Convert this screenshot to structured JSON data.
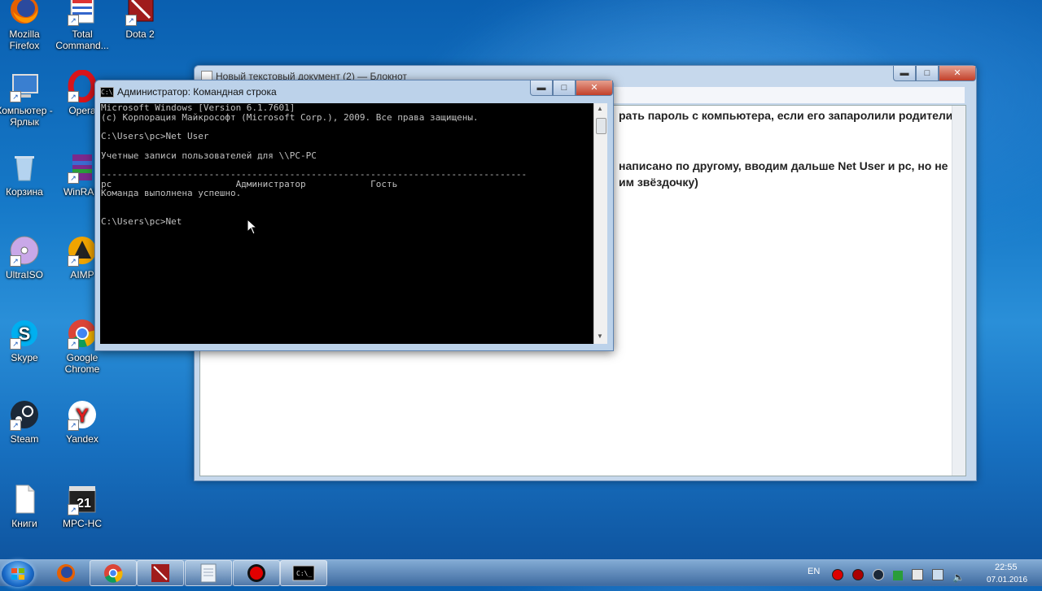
{
  "desktop": {
    "icons": [
      {
        "label": "Mozilla Firefox",
        "icon": "firefox-icon"
      },
      {
        "label": "Total Command...",
        "icon": "total-commander-icon"
      },
      {
        "label": "Dota 2",
        "icon": "dota2-icon"
      },
      {
        "label": "Компьютер - Ярлык",
        "icon": "computer-icon"
      },
      {
        "label": "Opera",
        "icon": "opera-icon"
      },
      {
        "label": "Корзина",
        "icon": "recycle-bin-icon"
      },
      {
        "label": "WinRAR",
        "icon": "winrar-icon"
      },
      {
        "label": "UltraISO",
        "icon": "ultraiso-icon"
      },
      {
        "label": "AIMP",
        "icon": "aimp-icon"
      },
      {
        "label": "Skype",
        "icon": "skype-icon"
      },
      {
        "label": "Google Chrome",
        "icon": "chrome-icon"
      },
      {
        "label": "Steam",
        "icon": "steam-icon"
      },
      {
        "label": "Yandex",
        "icon": "yandex-icon"
      },
      {
        "label": "Книги",
        "icon": "document-icon"
      },
      {
        "label": "MPC-HC",
        "icon": "mpc-hc-icon"
      }
    ]
  },
  "notepad": {
    "title": "Новый текстовый документ (2) — Блокнот",
    "line1": "рать пароль с компьютера, если его запаролили родители)",
    "line2": "написано по другому, вводим дальше Net User и pc, но не",
    "line3": "им звёздочку)"
  },
  "cmd": {
    "title": "Администратор: Командная строка",
    "output": "Microsoft Windows [Version 6.1.7601]\n(c) Корпорация Майкрософт (Microsoft Corp.), 2009. Все права защищены.\n\nC:\\Users\\pc>Net User\n\nУчетные записи пользователей для \\\\PC-PC\n\n-------------------------------------------------------------------------------\npc                       Администратор            Гость\nКоманда выполнена успешно.\n\n\nC:\\Users\\pc>Net"
  },
  "window_buttons": {
    "minimize": "▬",
    "maximize": "□",
    "close": "✕"
  },
  "tray": {
    "language": "EN",
    "time": "22:55",
    "date": "07.01.2016"
  },
  "colors": {
    "accent": "#1679c8",
    "close": "#c2402a"
  }
}
